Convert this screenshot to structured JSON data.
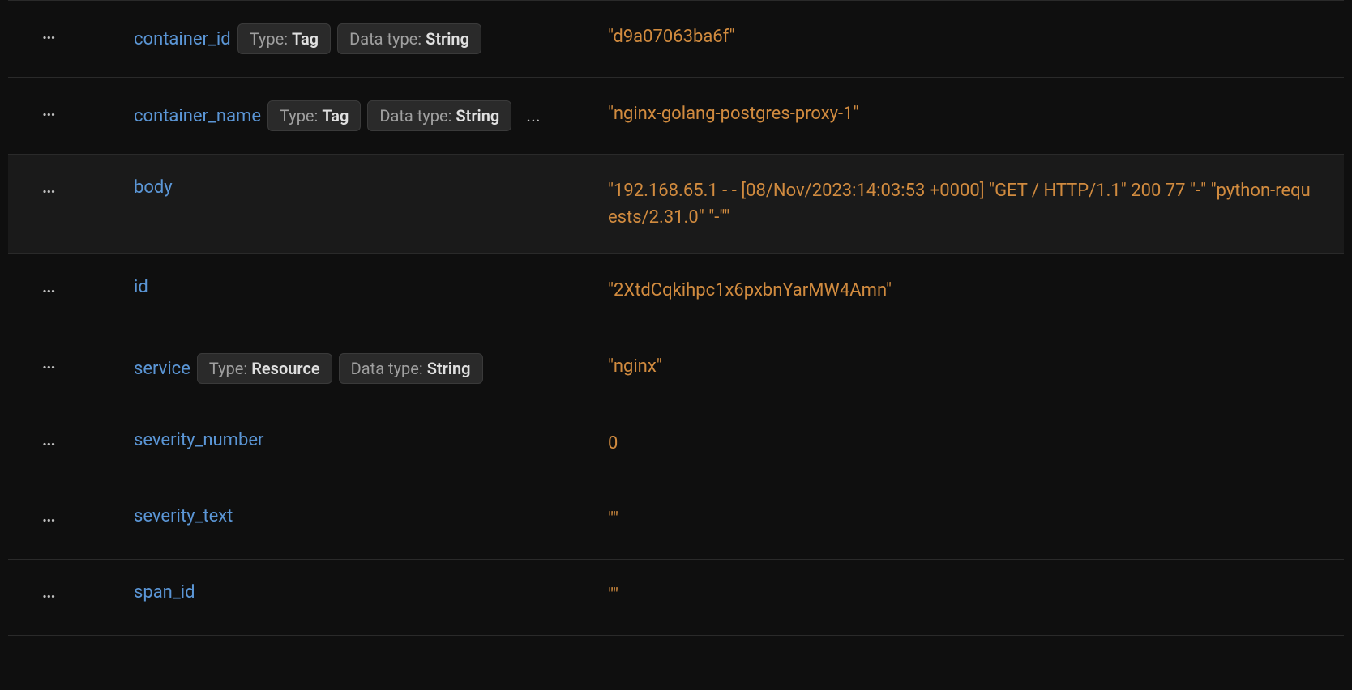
{
  "labels": {
    "type_prefix": "Type: ",
    "datatype_prefix": "Data type: ",
    "actions": "...",
    "overflow": "..."
  },
  "rows": [
    {
      "field": "container_id",
      "type": "Tag",
      "datatype": "String",
      "value": "\"d9a07063ba6f\"",
      "overflow": false,
      "highlight": false
    },
    {
      "field": "container_name",
      "type": "Tag",
      "datatype": "String",
      "value": "\"nginx-golang-postgres-proxy-1\"",
      "overflow": true,
      "highlight": false
    },
    {
      "field": "body",
      "type": null,
      "datatype": null,
      "value": "\"192.168.65.1 - - [08/Nov/2023:14:03:53 +0000] \"GET / HTTP/1.1\" 200 77 \"-\" \"python-requests/2.31.0\" \"-\"\"",
      "overflow": false,
      "highlight": true
    },
    {
      "field": "id",
      "type": null,
      "datatype": null,
      "value": "\"2XtdCqkihpc1x6pxbnYarMW4Amn\"",
      "overflow": false,
      "highlight": false
    },
    {
      "field": "service",
      "type": "Resource",
      "datatype": "String",
      "value": "\"nginx\"",
      "overflow": false,
      "highlight": false
    },
    {
      "field": "severity_number",
      "type": null,
      "datatype": null,
      "value": "0",
      "overflow": false,
      "highlight": false
    },
    {
      "field": "severity_text",
      "type": null,
      "datatype": null,
      "value": "\"\"",
      "overflow": false,
      "highlight": false
    },
    {
      "field": "span_id",
      "type": null,
      "datatype": null,
      "value": "\"\"",
      "overflow": false,
      "highlight": false
    }
  ]
}
